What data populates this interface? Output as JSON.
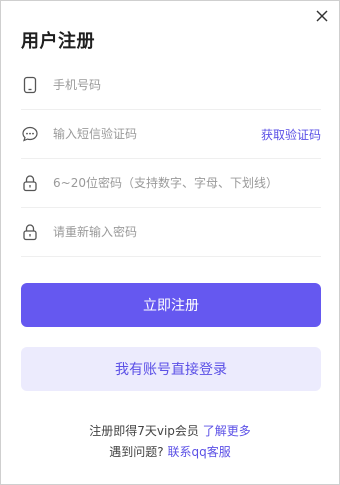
{
  "dialog": {
    "title": "用户注册",
    "close_icon": "close-icon"
  },
  "form": {
    "phone": {
      "placeholder": "手机号码",
      "value": "",
      "icon": "phone-icon"
    },
    "sms": {
      "placeholder": "输入短信验证码",
      "value": "",
      "icon": "chat-icon",
      "action_label": "获取验证码"
    },
    "password": {
      "placeholder": "6~20位密码（支持数字、字母、下划线）",
      "value": "",
      "icon": "lock-icon"
    },
    "confirm": {
      "placeholder": "请重新输入密码",
      "value": "",
      "icon": "lock-icon"
    }
  },
  "buttons": {
    "register": "立即注册",
    "login": "我有账号直接登录"
  },
  "footer": {
    "vip_text": "注册即得7天vip会员",
    "vip_link": "了解更多",
    "help_text": "遇到问题?",
    "help_link": "联系qq客服"
  },
  "colors": {
    "accent": "#6558f0",
    "accent_light": "#ecebfd",
    "link": "#5b50e6"
  }
}
